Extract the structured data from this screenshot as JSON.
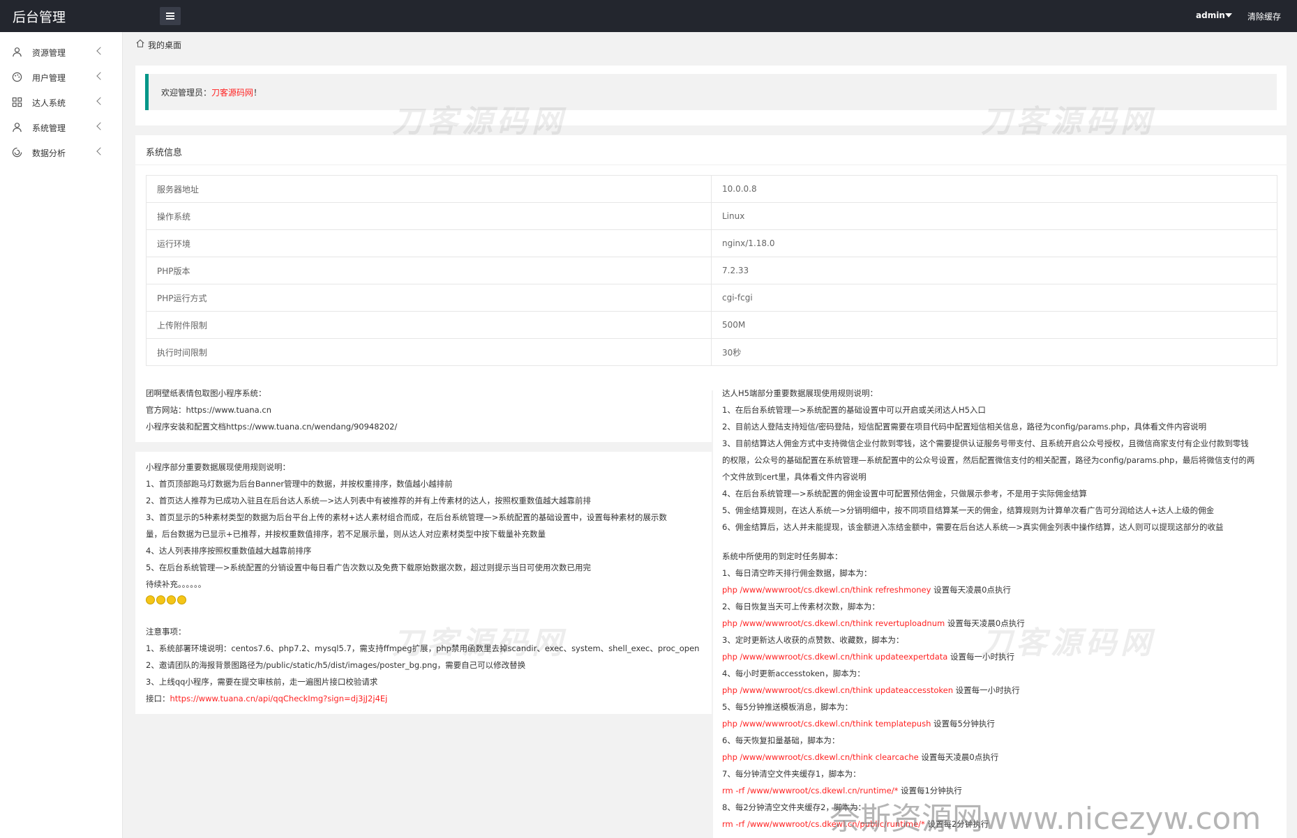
{
  "header": {
    "brand": "后台管理",
    "user": "admin",
    "clear_cache": "清除缓存"
  },
  "sidebar": {
    "items": [
      {
        "label": "资源管理",
        "icon": "user-icon"
      },
      {
        "label": "用户管理",
        "icon": "palette-icon"
      },
      {
        "label": "达人系统",
        "icon": "grid-icon"
      },
      {
        "label": "系统管理",
        "icon": "user-icon"
      },
      {
        "label": "数据分析",
        "icon": "loading-icon"
      }
    ]
  },
  "breadcrumb": {
    "label": "我的桌面"
  },
  "welcome": {
    "prefix": "欢迎管理员：",
    "name": "刀客源码网",
    "suffix": "！"
  },
  "system_info": {
    "title": "系统信息",
    "rows": [
      {
        "key": "服务器地址",
        "value": "10.0.0.8"
      },
      {
        "key": "操作系统",
        "value": "Linux"
      },
      {
        "key": "运行环境",
        "value": "nginx/1.18.0"
      },
      {
        "key": "PHP版本",
        "value": "7.2.33"
      },
      {
        "key": "PHP运行方式",
        "value": "cgi-fcgi"
      },
      {
        "key": "上传附件限制",
        "value": "500M"
      },
      {
        "key": "执行时间限制",
        "value": "30秒"
      }
    ]
  },
  "app_info": [
    "团啊壁纸表情包取图小程序系统：",
    "官方网站：https://www.tuana.cn",
    "小程序安装和配置文档https://www.tuana.cn/wendang/90948202/"
  ],
  "miniapp_rules": {
    "title": "小程序部分重要数据展现使用规则说明：",
    "lines": [
      "1、首页顶部跑马灯数据为后台Banner管理中的数据，并按权重排序，数值越小越排前",
      "2、首页达人推荐为已成功入驻且在后台达人系统—>达人列表中有被推荐的并有上传素材的达人，按照权重数值越大越靠前排",
      "3、首页显示的5种素材类型的数据为后台平台上传的素材+达人素材组合而成，在后台系统管理—>系统配置的基础设置中，设置每种素材的展示数",
      "量，后台数据为已显示+已推荐，并按权重数值排序，若不足展示量，则从达人对应素材类型中按下载量补充数量",
      "4、达人列表排序按照权重数值越大越靠前排序",
      "5、在后台系统管理—>系统配置的分销设置中每日看广告次数以及免费下载原始数据次数，超过则提示当日可使用次数已用完",
      "待续补充。。。。。。"
    ]
  },
  "notes": {
    "title": "注意事项：",
    "lines": [
      "1、系统部署环境说明：centos7.6、php7.2、mysql5.7，需支持ffmpeg扩展，php禁用函数里去掉scandir、exec、system、shell_exec、proc_open",
      "2、邀请团队的海报背景图路径为/public/static/h5/dist/images/poster_bg.png，需要自己可以修改替换",
      "3、上线qq小程序，需要在提交审核前，走一遍图片接口校验请求"
    ],
    "api_label": "接口：",
    "api_url": "https://www.tuana.cn/api/qqCheckImg?sign=dj3jJ2j4Ej"
  },
  "h5_rules": {
    "title": "达人H5端部分重要数据展现使用规则说明：",
    "lines": [
      "1、在后台系统管理—>系统配置的基础设置中可以开启或关闭达人H5入口",
      "2、目前达人登陆支持短信/密码登陆，短信配置需要在项目代码中配置短信相关信息，路径为config/params.php，具体看文件内容说明",
      "3、目前结算达人佣金方式中支持微信企业付款到零钱，这个需要提供认证服务号带支付、且系统开启公众号授权，且微信商家支付有企业付款到零钱",
      "的权限，公众号的基础配置在系统管理—系统配置中的公众号设置，然后配置微信支付的相关配置，路径为config/params.php，最后将微信支付的两",
      "个文件放到cert里，具体看文件内容说明",
      "4、在后台系统管理—>系统配置的佣金设置中可配置预估佣金，只做展示参考，不是用于实际佣金结算",
      "5、佣金结算规则，在达人系统—>分销明细中，按不同项目结算某一天的佣金，结算规则为计算单次看广告可分润给达人+达人上级的佣金",
      "6、佣金结算后，达人并未能提现，该金额进入冻结金额中，需要在后台达人系统—>真实佣金列表中操作结算，达人则可以提现这部分的收益"
    ]
  },
  "cron": {
    "title": "系统中所使用的到定时任务脚本：",
    "tasks": [
      {
        "desc": "1、每日清空昨天排行佣金数据，脚本为：",
        "cmd": "php /www/wwwroot/cs.dkewl.cn/think refreshmoney",
        "note": " 设置每天凌晨0点执行"
      },
      {
        "desc": "2、每日恢复当天可上传素材次数，脚本为：",
        "cmd": "php /www/wwwroot/cs.dkewl.cn/think revertuploadnum",
        "note": " 设置每天凌晨0点执行"
      },
      {
        "desc": "3、定时更新达人收获的点赞数、收藏数，脚本为：",
        "cmd": "php /www/wwwroot/cs.dkewl.cn/think updateexpertdata",
        "note": " 设置每一小时执行"
      },
      {
        "desc": "4、每小时更新accesstoken，脚本为：",
        "cmd": "php /www/wwwroot/cs.dkewl.cn/think updateaccesstoken",
        "note": " 设置每一小时执行"
      },
      {
        "desc": "5、每5分钟推送模板消息，脚本为：",
        "cmd": "php /www/wwwroot/cs.dkewl.cn/think templatepush",
        "note": " 设置每5分钟执行"
      },
      {
        "desc": "6、每天恢复扣量基础，脚本为：",
        "cmd": "php /www/wwwroot/cs.dkewl.cn/think clearcache",
        "note": " 设置每天凌晨0点执行"
      },
      {
        "desc": "7、每分钟清空文件夹缓存1，脚本为：",
        "cmd": "rm -rf /www/wwwroot/cs.dkewl.cn/runtime/*",
        "note": " 设置每1分钟执行"
      },
      {
        "desc": "8、每2分钟清空文件夹缓存2，脚本为：",
        "cmd": "rm -rf /www/wwwroot/cs.dkewl.cn/public/runtime/*",
        "note": " 设置每2分钟执行"
      }
    ]
  },
  "watermark": "刀客源码网",
  "bottom_watermark": "奈斯资源网www.nicezyw.com",
  "colors": {
    "accent": "#009688",
    "topbar": "#23262e",
    "link_red": "#ff2222"
  }
}
